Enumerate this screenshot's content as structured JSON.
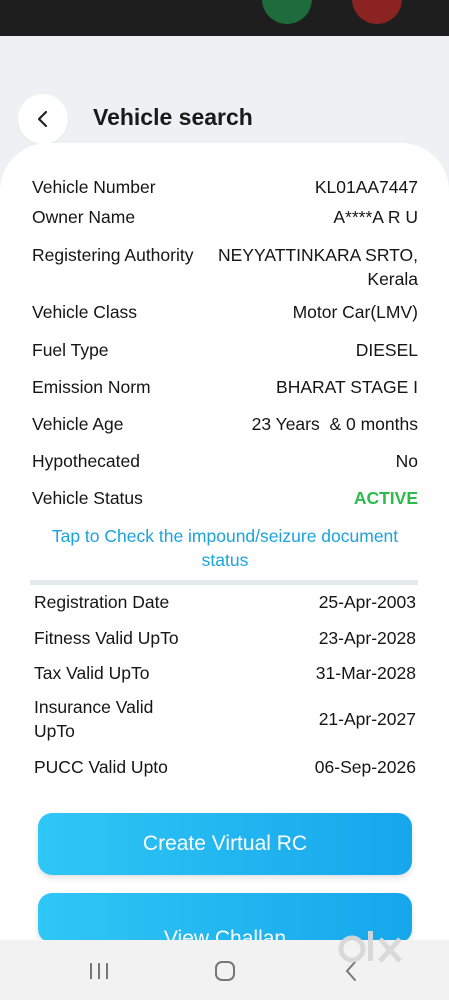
{
  "header": {
    "title": "Vehicle search"
  },
  "details": [
    {
      "label": "Vehicle Number",
      "value": "KL01AA7447"
    },
    {
      "label": "Owner Name",
      "value": "A****A R U"
    },
    {
      "label": "Registering Authority",
      "value_line1": "NEYYATTINKARA SRTO,",
      "value_line2": "Kerala"
    },
    {
      "label": "Vehicle Class",
      "value": "Motor Car(LMV)"
    },
    {
      "label": "Fuel Type",
      "value": "DIESEL"
    },
    {
      "label": "Emission Norm",
      "value": "BHARAT STAGE I"
    },
    {
      "label": "Vehicle Age",
      "value": "23 Years  & 0 months"
    },
    {
      "label": "Hypothecated",
      "value": "No"
    },
    {
      "label": "Vehicle Status",
      "value": "ACTIVE"
    }
  ],
  "impound_link": {
    "line1": "Tap to Check the impound/seizure document",
    "line2": "status"
  },
  "validity": [
    {
      "label": "Registration Date",
      "value": "25-Apr-2003"
    },
    {
      "label": "Fitness Valid UpTo",
      "value": "23-Apr-2028"
    },
    {
      "label": "Tax Valid UpTo",
      "value": "31-Mar-2028"
    },
    {
      "label_line1": "Insurance Valid",
      "label_line2": "UpTo",
      "value": "21-Apr-2027"
    },
    {
      "label": "PUCC Valid Upto",
      "value": "06-Sep-2026"
    }
  ],
  "buttons": {
    "virtual_rc": "Create Virtual RC",
    "view_challan": "View Challan"
  },
  "watermark": {
    "text": "olx"
  },
  "colors": {
    "accent": "#1aa3dc",
    "status_active": "#2dbb4c",
    "button": "#16a6ec"
  }
}
